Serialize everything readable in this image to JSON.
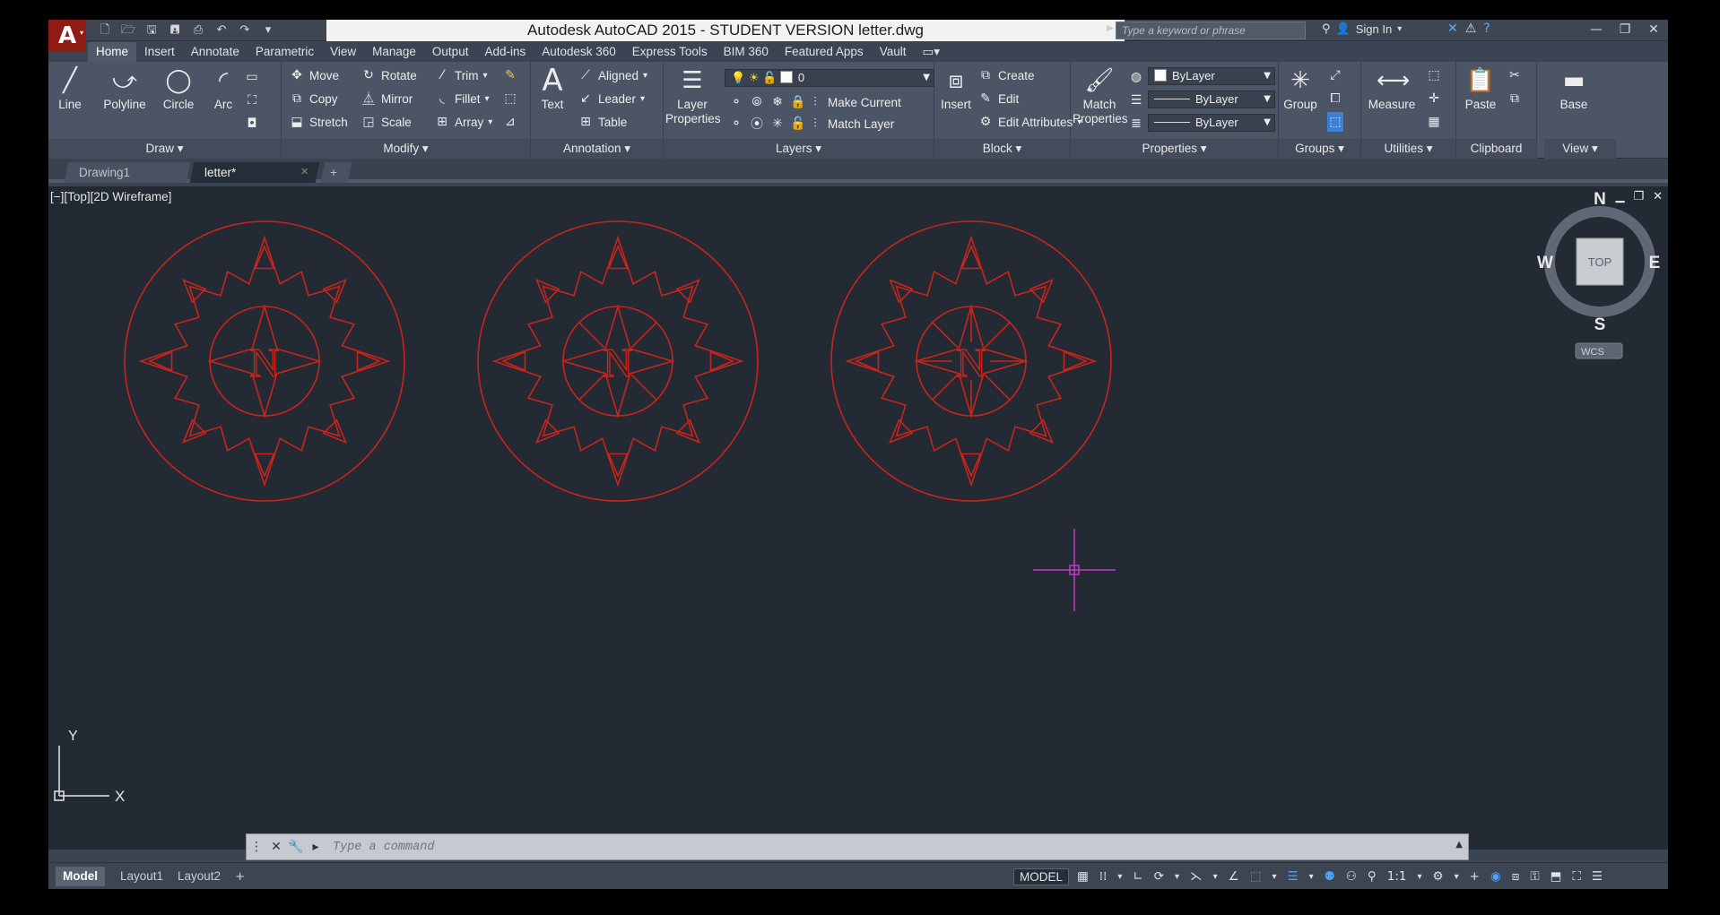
{
  "window": {
    "title": "Autodesk AutoCAD 2015 - STUDENT VERSION    letter.dwg",
    "search_placeholder": "Type a keyword or phrase",
    "sign_in": "Sign In",
    "app_letter": "A"
  },
  "qat_icons": [
    "new-icon",
    "open-icon",
    "save-icon",
    "save-as-icon",
    "plot-icon",
    "undo-icon",
    "redo-icon",
    "customize-icon"
  ],
  "ribbon_tabs": [
    "Home",
    "Insert",
    "Annotate",
    "Parametric",
    "View",
    "Manage",
    "Output",
    "Add-ins",
    "Autodesk 360",
    "Express Tools",
    "BIM 360",
    "Featured Apps",
    "Vault"
  ],
  "active_tab": "Home",
  "panels": {
    "draw": {
      "title": "Draw ▾",
      "line": "Line",
      "polyline": "Polyline",
      "circle": "Circle",
      "arc": "Arc"
    },
    "modify": {
      "title": "Modify ▾",
      "move": "Move",
      "rotate": "Rotate",
      "trim": "Trim",
      "copy": "Copy",
      "mirror": "Mirror",
      "fillet": "Fillet",
      "stretch": "Stretch",
      "scale": "Scale",
      "array": "Array"
    },
    "annotation": {
      "title": "Annotation ▾",
      "text": "Text",
      "aligned": "Aligned",
      "leader": "Leader",
      "table": "Table"
    },
    "layers": {
      "title": "Layers ▾",
      "layer_properties_1": "Layer",
      "layer_properties_2": "Properties",
      "current_layer": "0",
      "make_current": "Make Current",
      "match_layer": "Match Layer"
    },
    "block": {
      "title": "Block ▾",
      "insert": "Insert",
      "create": "Create",
      "edit": "Edit",
      "edit_attributes": "Edit Attributes"
    },
    "properties": {
      "title": "Properties ▾",
      "match_1": "Match",
      "match_2": "Properties",
      "color": "ByLayer",
      "linetype": "ByLayer",
      "lineweight": "ByLayer"
    },
    "groups": {
      "title": "Groups ▾",
      "group": "Group"
    },
    "utilities": {
      "title": "Utilities ▾",
      "measure": "Measure"
    },
    "clipboard": {
      "title": "Clipboard",
      "paste": "Paste"
    },
    "view": {
      "title": "View ▾",
      "base": "Base"
    }
  },
  "file_tabs": [
    "Drawing1",
    "letter*"
  ],
  "active_file": "letter*",
  "viewport": {
    "label": "[−][Top][2D Wireframe]",
    "viewcube": {
      "n": "N",
      "s": "S",
      "e": "E",
      "w": "W",
      "face": "TOP",
      "wcs": "WCS"
    },
    "ucs_x": "X",
    "ucs_y": "Y",
    "compass_letters": [
      "N",
      "N",
      "N"
    ],
    "drawing_color": "#c8241c",
    "crosshair_color": "#c43ac8"
  },
  "command": {
    "placeholder": "Type a command"
  },
  "layout_tabs": [
    "Model",
    "Layout1",
    "Layout2"
  ],
  "active_layout": "Model",
  "status": {
    "model": "MODEL",
    "scale": "1:1"
  }
}
